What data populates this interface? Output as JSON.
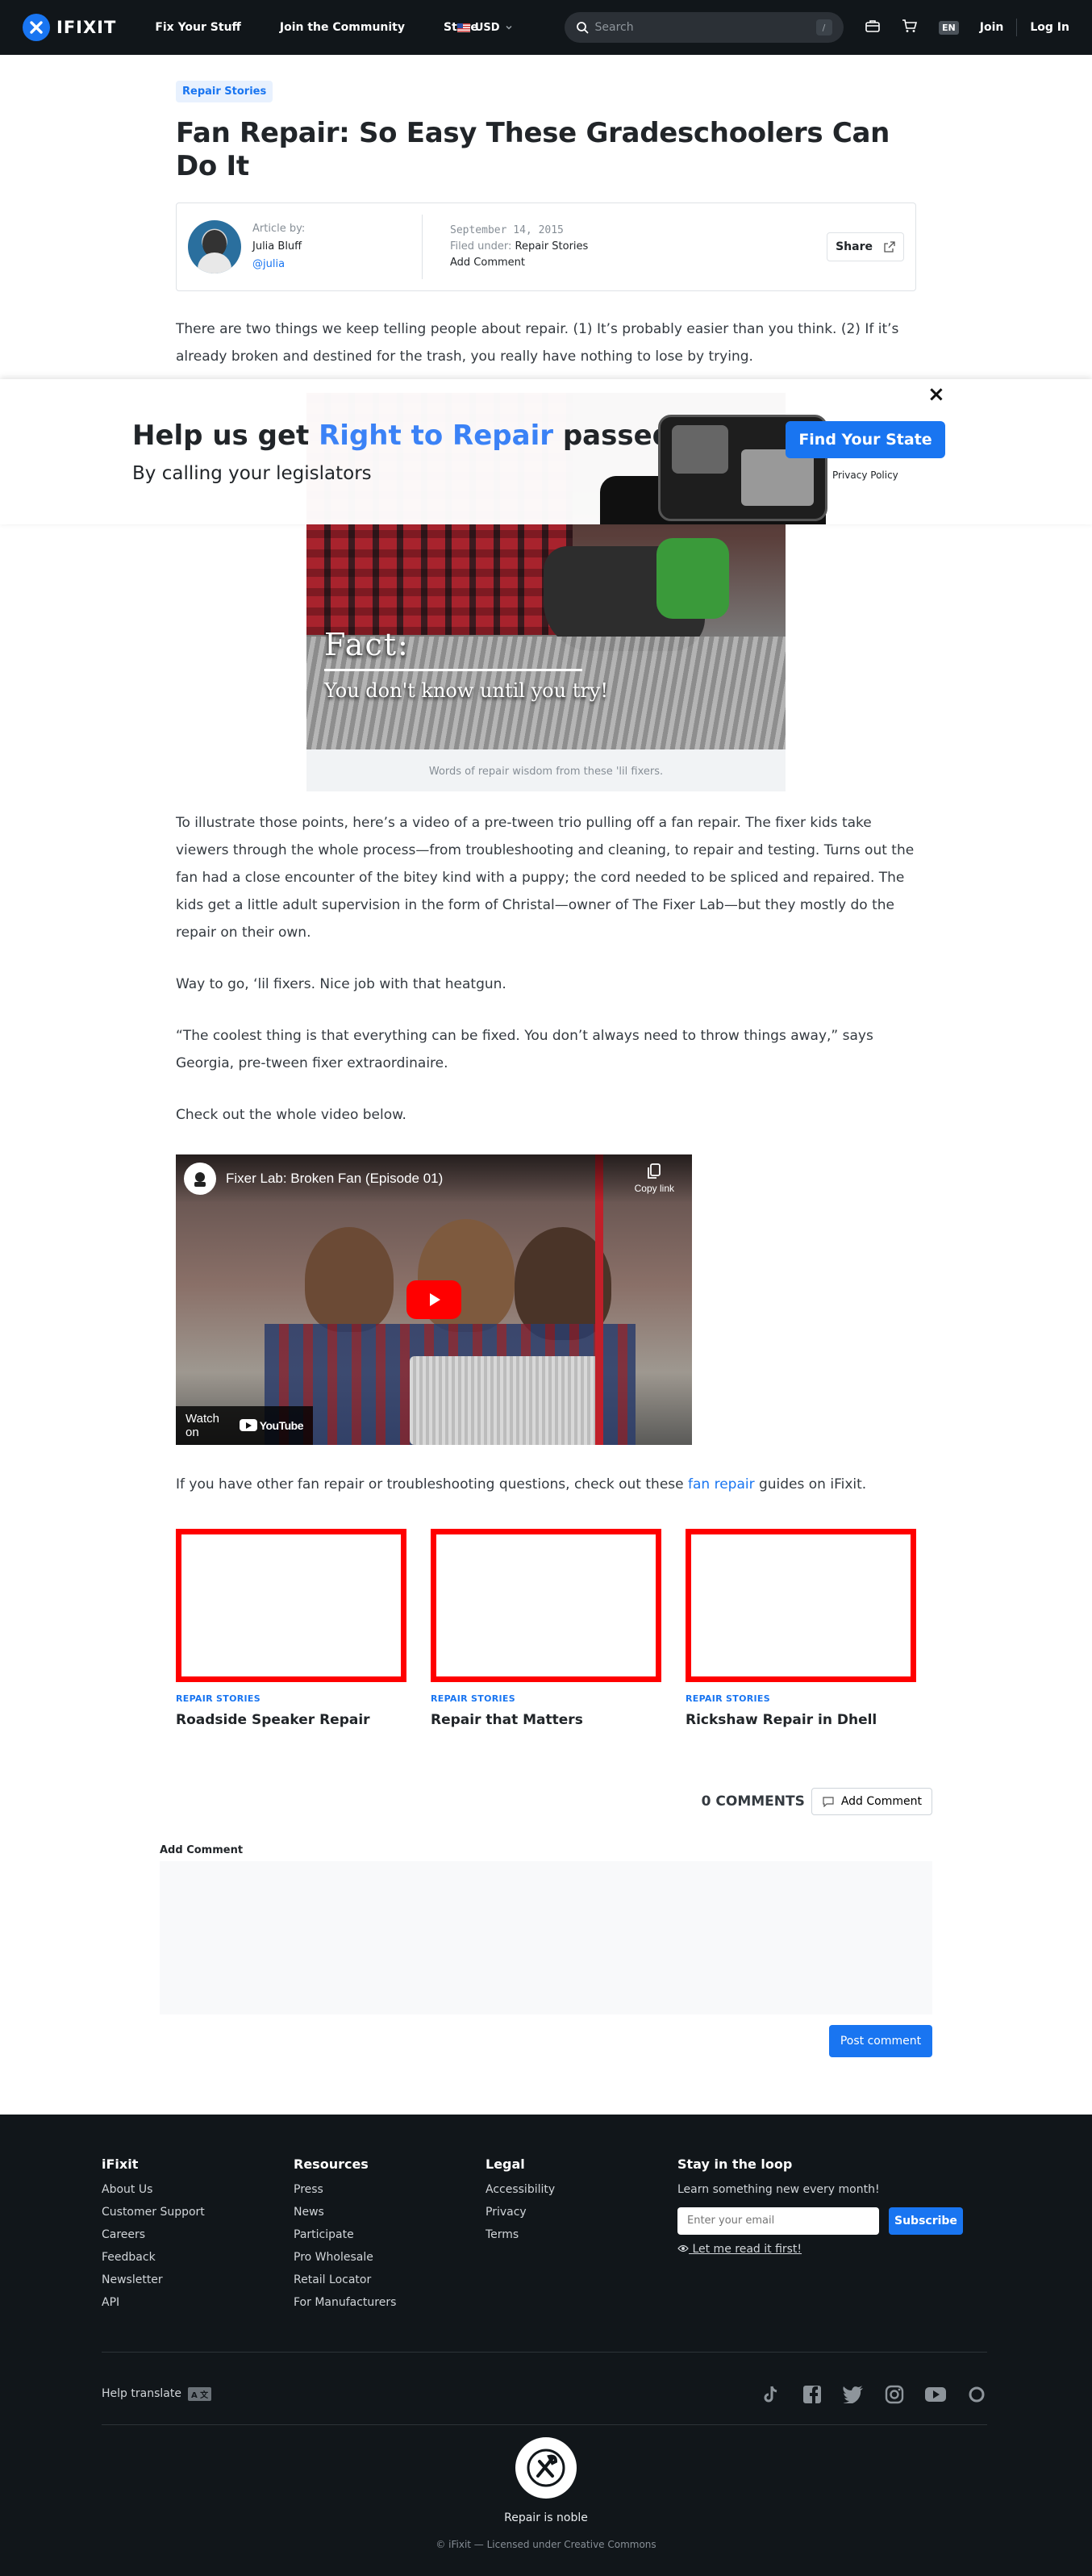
{
  "header": {
    "logo_text": "IFIXIT",
    "nav": [
      "Fix Your Stuff",
      "Join the Community",
      "Store"
    ],
    "currency": "USD",
    "search_placeholder": "Search",
    "search_shortcut": "/",
    "lang": "EN",
    "join": "Join",
    "login": "Log In"
  },
  "article": {
    "tag": "Repair Stories",
    "title": "Fan Repair: So Easy These Gradeschoolers Can Do It",
    "byline": {
      "label": "Article by:",
      "author": "Julia Bluff",
      "handle": "@julia",
      "date": "September 14, 2015",
      "filed_label": "Filed under:",
      "filed_value": "Repair Stories",
      "add_comment": "Add Comment",
      "share": "Share"
    },
    "intro": "There are two things we keep telling people about repair. (1) It’s probably easier than you think. (2) If it’s already broken and destined for the trash, you really have nothing to lose by trying.",
    "figure": {
      "fact_title": "Fact:",
      "fact_text": "You don't know until you try!",
      "caption": "Words of repair wisdom from these 'lil fixers."
    },
    "paragraphs": [
      "To illustrate those points, here’s a video of a pre-tween trio pulling off a fan repair. The fixer kids take viewers through the whole process—from troubleshooting and cleaning, to repair and testing. Turns out the fan had a close encounter of the bitey kind with a puppy; the cord needed to be spliced and repaired. The kids get a little adult supervision in the form of Christal—owner of The Fixer Lab—but they mostly do the repair on their own.",
      "Way to go, ‘lil fixers. Nice job with that heatgun.",
      "“The coolest thing is that everything can be fixed. You don’t always need to throw things away,” says Georgia, pre-tween fixer extraordinaire.",
      "Check out the whole video below."
    ],
    "video": {
      "title": "Fixer Lab: Broken Fan (Episode 01)",
      "copy_link": "Copy link",
      "watch_on": "Watch on",
      "youtube": "YouTube"
    },
    "outro_before": "If you have other fan repair or troubleshooting questions, check out these ",
    "outro_link": "fan repair",
    "outro_after": " guides on iFixit."
  },
  "banner": {
    "title_a": "Help us get ",
    "title_highlight": "Right to Repair",
    "title_b": " passed",
    "subtitle": "By calling your legislators",
    "cta": "Find Your State",
    "privacy": "Privacy Policy",
    "close": "×",
    "accent": "#3b82f6"
  },
  "related": [
    {
      "kicker": "REPAIR STORIES",
      "title": "Roadside Speaker Repair"
    },
    {
      "kicker": "REPAIR STORIES",
      "title": "Repair that Matters"
    },
    {
      "kicker": "REPAIR STORIES",
      "title": "Rickshaw Repair in Dhell"
    }
  ],
  "comments": {
    "count": "0 COMMENTS",
    "add_button": "Add Comment",
    "label": "Add Comment",
    "post": "Post comment"
  },
  "footer": {
    "cols": [
      {
        "title": "iFixit",
        "links": [
          "About Us",
          "Customer Support",
          "Careers",
          "Feedback",
          "Newsletter",
          "API"
        ]
      },
      {
        "title": "Resources",
        "links": [
          "Press",
          "News",
          "Participate",
          "Pro Wholesale",
          "Retail Locator",
          "For Manufacturers"
        ]
      },
      {
        "title": "Legal",
        "links": [
          "Accessibility",
          "Privacy",
          "Terms"
        ]
      }
    ],
    "stay_title": "Stay in the loop",
    "stay_text": "Learn something new every month!",
    "email_placeholder": "Enter your email",
    "subscribe": "Subscribe",
    "read_first": "Let me read it first!",
    "help_translate": "Help translate",
    "tagline": "Repair is noble",
    "license": "© iFixit — Licensed under Creative Commons",
    "brand_color": "#1975f1"
  }
}
